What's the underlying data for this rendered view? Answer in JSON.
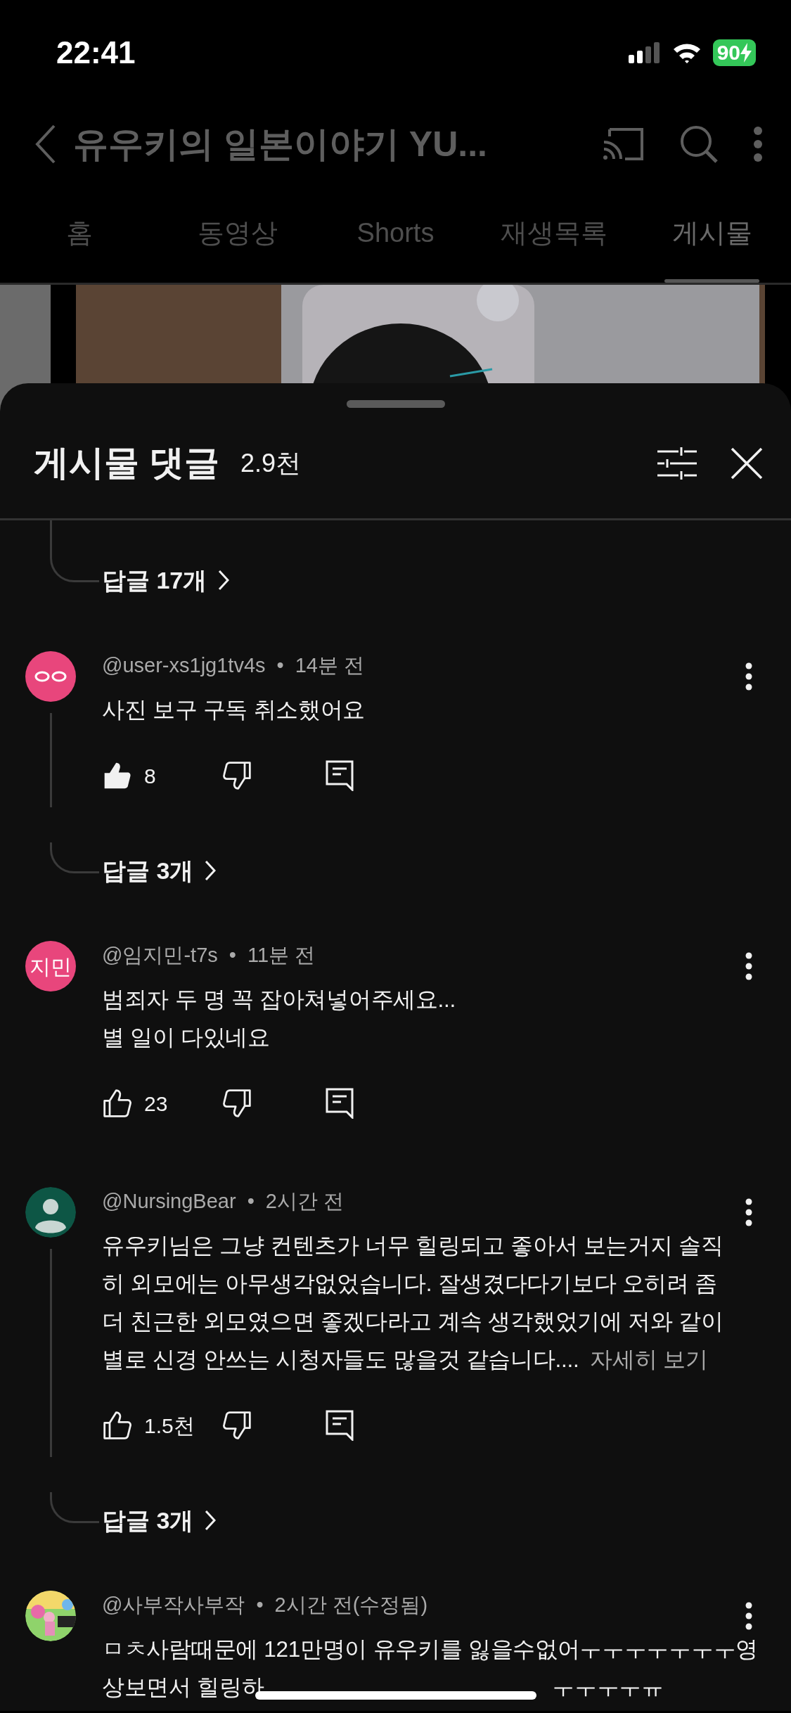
{
  "status_bar": {
    "time": "22:41",
    "battery": "90"
  },
  "header": {
    "title": "유우키의 일본이야기 YU..."
  },
  "tabs": [
    {
      "label": "홈",
      "selected": false
    },
    {
      "label": "동영상",
      "selected": false
    },
    {
      "label": "Shorts",
      "selected": false
    },
    {
      "label": "재생목록",
      "selected": false
    },
    {
      "label": "게시물",
      "selected": true
    }
  ],
  "sheet": {
    "title": "게시물 댓글",
    "count": "2.9천",
    "previous_replies": "답글 17개"
  },
  "comments": [
    {
      "author": "@user-xs1jg1tv4s",
      "separator": "•",
      "time": "14분 전",
      "avatar": {
        "kind": "eyes",
        "color": "#e8467c"
      },
      "text": [
        "사진 보구 구독 취소했어요"
      ],
      "likes": "8",
      "liked": true,
      "replies": "답글 3개"
    },
    {
      "author": "@임지민-t7s",
      "separator": "•",
      "time": "11분 전",
      "avatar": {
        "kind": "initials",
        "color": "#e8467c",
        "label": "지민"
      },
      "text": [
        "범죄자 두 명 꼭 잡아쳐넣어주세요...",
        "별 일이 다있네요"
      ],
      "likes": "23",
      "liked": false
    },
    {
      "author": "@NursingBear",
      "separator": "•",
      "time": "2시간 전",
      "avatar": {
        "kind": "silhouette",
        "color": "#0d5645"
      },
      "text": [
        "유우키님은 그냥 컨텐츠가 너무 힐링되고 좋아서 보는거지 솔직",
        "히 외모에는 아무생각없었습니다. 잘생겼다다기보다 오히려 좀",
        "더 친근한 외모였으면 좋겠다라고 계속 생각했었기에 저와 같이",
        "별로 신경 안쓰는 시청자들도 많을것 같습니다...."
      ],
      "more": "자세히 보기",
      "likes": "1.5천",
      "liked": false,
      "replies": "답글 3개"
    },
    {
      "author": "@사부작사부작",
      "separator": "•",
      "time": "2시간 전(수정됨)",
      "text": [
        "ㅁㅊ사람때문에 121만명이 유우키를 잃을수없어ㅜㅜㅜㅜㅜㅜㅜ영",
        "상보면서 힐링하"
      ],
      "text_tail": "ㅜㅜㅜㅜㅠ"
    }
  ]
}
